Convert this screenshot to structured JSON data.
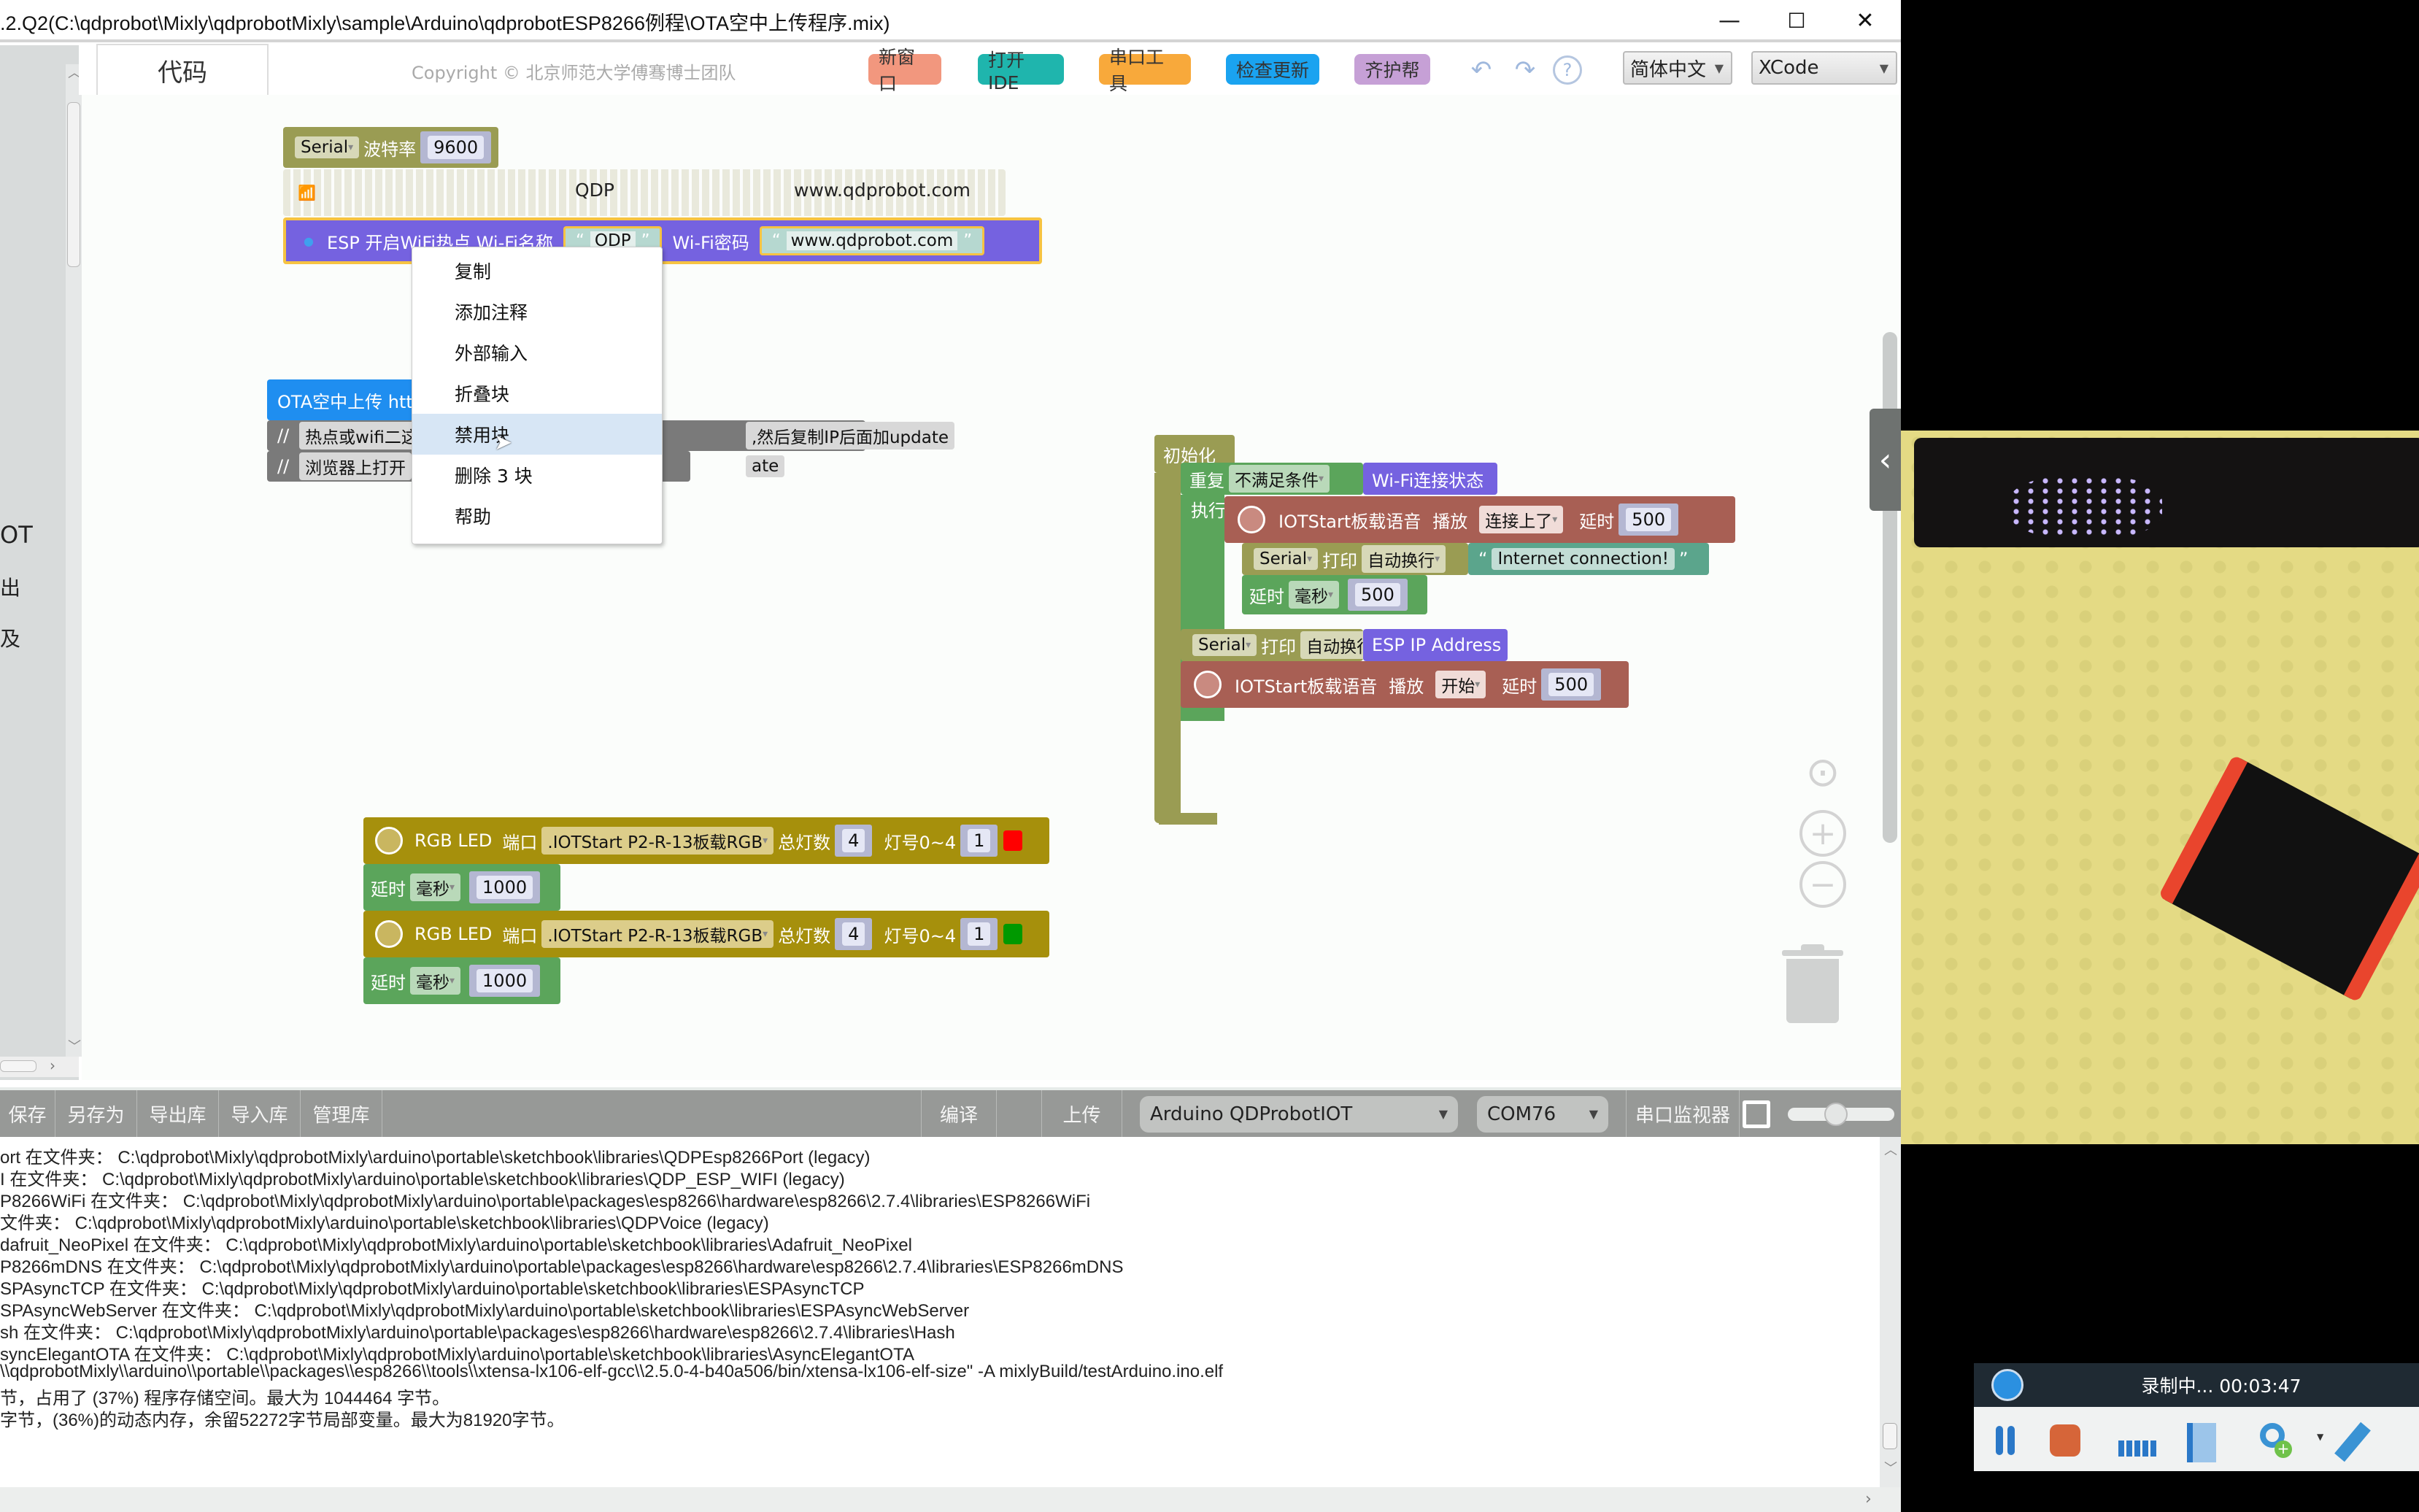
{
  "window": {
    "title": ".2.Q2(C:\\qdprobot\\Mixly\\qdprobotMixly\\sample\\Arduino\\qdprobotESP8266例程\\OTA空中上传程序.mix)",
    "minimize": "—",
    "maximize": "☐",
    "close": "✕"
  },
  "left_panel": {
    "labels": [
      "OT",
      "出",
      "及"
    ]
  },
  "header": {
    "tab_code": "代码",
    "copyright": "Copyright © 北京师范大学傅骞博士团队",
    "buttons": [
      {
        "label": "新窗口",
        "color": "#f2977e"
      },
      {
        "label": "打开IDE",
        "color": "#1fb5ad"
      },
      {
        "label": "串口工具",
        "color": "#f8a93b"
      },
      {
        "label": "检查更新",
        "color": "#1aa3f0"
      },
      {
        "label": "齐护帮",
        "color": "#c6a0d6"
      }
    ],
    "undo_icon": "↶",
    "redo_icon": "↷",
    "help_icon": "?",
    "language_select": "简体中文",
    "theme_select": "XCode"
  },
  "blocks": {
    "serial_begin": {
      "port": "Serial",
      "label": "波特率",
      "baud": "9600"
    },
    "wifi_disabled": {
      "ssid": "QDP",
      "password": "www.qdprobot.com"
    },
    "wifi_ap": {
      "label": "ESP 开启WiFi热点  Wi-Fi名称",
      "ssid": "ODP",
      "pwd_label": "Wi-Fi密码",
      "password": "www.qdprobot.com"
    },
    "ota": {
      "header": "OTA空中上传 htt",
      "comment1_start": "热点或wifi二这",
      "comment1_end": ",然后复制IP后面加update",
      "comment2_start": "浏览器上打开",
      "comment2_end": "ate"
    },
    "setup": {
      "label": "初始化",
      "repeat": "重复",
      "condition_mode": "不满足条件",
      "condition": "Wi-Fi连接状态",
      "do": "执行",
      "voice1": {
        "label": "IOTStart板载语音",
        "play": "播放",
        "clip": "连接上了",
        "delay_label": "延时",
        "delay": "500"
      },
      "print1": {
        "port": "Serial",
        "action": "打印",
        "mode": "自动换行",
        "text": "Internet connection!"
      },
      "delay1": {
        "label": "延时",
        "unit": "毫秒",
        "value": "500"
      },
      "print2": {
        "port": "Serial",
        "action": "打印",
        "mode": "自动换行",
        "text": "ESP IP Address"
      },
      "voice2": {
        "label": "IOTStart板载语音",
        "play": "播放",
        "clip": "开始",
        "delay_label": "延时",
        "delay": "500"
      }
    },
    "rgb": [
      {
        "label": "RGB LED",
        "port_label": "端口",
        "port": ".IOTStart P2-R-13板载RGB",
        "total_label": "总灯数",
        "total": "4",
        "index_label": "灯号0~4",
        "index": "1",
        "color": "#ff0000"
      },
      {
        "label": "RGB LED",
        "port_label": "端口",
        "port": ".IOTStart P2-R-13板载RGB",
        "total_label": "总灯数",
        "total": "4",
        "index_label": "灯号0~4",
        "index": "1",
        "color": "#009900"
      }
    ],
    "rgb_delay": [
      {
        "label": "延时",
        "unit": "毫秒",
        "value": "1000"
      },
      {
        "label": "延时",
        "unit": "毫秒",
        "value": "1000"
      }
    ]
  },
  "context_menu": {
    "items": [
      "复制",
      "添加注释",
      "外部输入",
      "折叠块",
      "禁用块",
      "删除 3 块",
      "帮助"
    ],
    "highlighted_index": 4
  },
  "toolbar": {
    "save": "保存",
    "save_as": "另存为",
    "export_lib": "导出库",
    "import_lib": "导入库",
    "manage_lib": "管理库",
    "compile": "编译",
    "upload": "上传",
    "board": "Arduino QDProbotIOT",
    "port": "COM76",
    "serial_monitor": "串口监视器",
    "slider_value": 0.45
  },
  "log_lines": [
    "ort 在文件夹：  C:\\qdprobot\\Mixly\\qdprobotMixly\\arduino\\portable\\sketchbook\\libraries\\QDPEsp8266Port (legacy)",
    "I 在文件夹：  C:\\qdprobot\\Mixly\\qdprobotMixly\\arduino\\portable\\sketchbook\\libraries\\QDP_ESP_WIFI (legacy)",
    "P8266WiFi 在文件夹：  C:\\qdprobot\\Mixly\\qdprobotMixly\\arduino\\portable\\packages\\esp8266\\hardware\\esp8266\\2.7.4\\libraries\\ESP8266WiFi",
    "文件夹：  C:\\qdprobot\\Mixly\\qdprobotMixly\\arduino\\portable\\sketchbook\\libraries\\QDPVoice (legacy)",
    "dafruit_NeoPixel 在文件夹：  C:\\qdprobot\\Mixly\\qdprobotMixly\\arduino\\portable\\sketchbook\\libraries\\Adafruit_NeoPixel",
    "P8266mDNS 在文件夹：  C:\\qdprobot\\Mixly\\qdprobotMixly\\arduino\\portable\\packages\\esp8266\\hardware\\esp8266\\2.7.4\\libraries\\ESP8266mDNS",
    "SPAsyncTCP 在文件夹：  C:\\qdprobot\\Mixly\\qdprobotMixly\\arduino\\portable\\sketchbook\\libraries\\ESPAsyncTCP",
    "SPAsyncWebServer 在文件夹：  C:\\qdprobot\\Mixly\\qdprobotMixly\\arduino\\portable\\sketchbook\\libraries\\ESPAsyncWebServer",
    "sh 在文件夹：  C:\\qdprobot\\Mixly\\qdprobotMixly\\arduino\\portable\\packages\\esp8266\\hardware\\esp8266\\2.7.4\\libraries\\Hash",
    "syncElegantOTA 在文件夹：  C:\\qdprobot\\Mixly\\qdprobotMixly\\arduino\\portable\\sketchbook\\libraries\\AsyncElegantOTA",
    "\\\\qdprobotMixly\\\\arduino\\\\portable\\\\packages\\\\esp8266\\\\tools\\\\xtensa-lx106-elf-gcc\\\\2.5.0-4-b40a506/bin/xtensa-lx106-elf-size\" -A mixlyBuild/testArduino.ino.elf",
    "节，占用了 (37%) 程序存储空间。最大为 1044464 字节。",
    "字节，(36%)的动态内存，余留52272字节局部变量。最大为81920字节。"
  ],
  "recorder": {
    "status": "录制中... 00:03:47"
  }
}
